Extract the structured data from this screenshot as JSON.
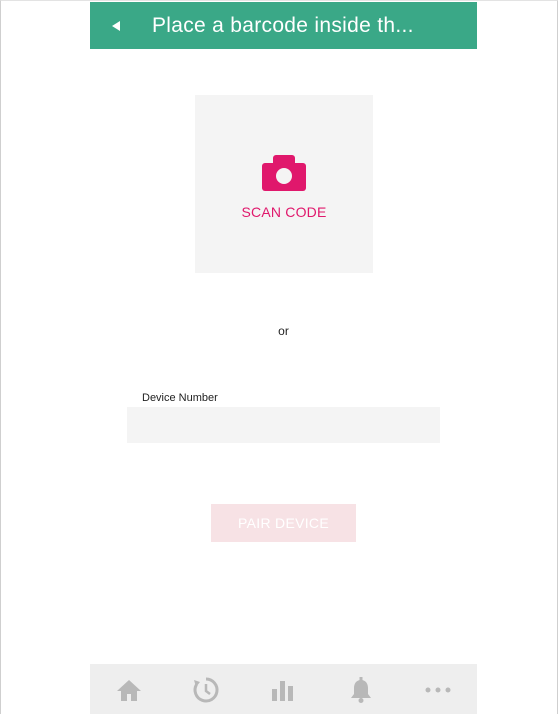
{
  "header": {
    "back_icon": "back-arrow-icon",
    "title": "Place a barcode inside th..."
  },
  "scan": {
    "icon": "camera-icon",
    "label": "SCAN CODE"
  },
  "separator": {
    "text": "or"
  },
  "device": {
    "label": "Device Number",
    "value": "",
    "placeholder": ""
  },
  "pair_button": {
    "label": "PAIR DEVICE"
  },
  "tabbar": {
    "items": [
      {
        "icon": "home-icon"
      },
      {
        "icon": "history-icon"
      },
      {
        "icon": "stats-icon"
      },
      {
        "icon": "bell-icon"
      },
      {
        "icon": "more-icon"
      }
    ]
  },
  "colors": {
    "header_bg": "#3aa887",
    "accent": "#e0186c",
    "pair_button_disabled": "#f7e2e5",
    "tabbar_bg": "#eeeeee",
    "tab_icon": "#b8b8b8"
  }
}
